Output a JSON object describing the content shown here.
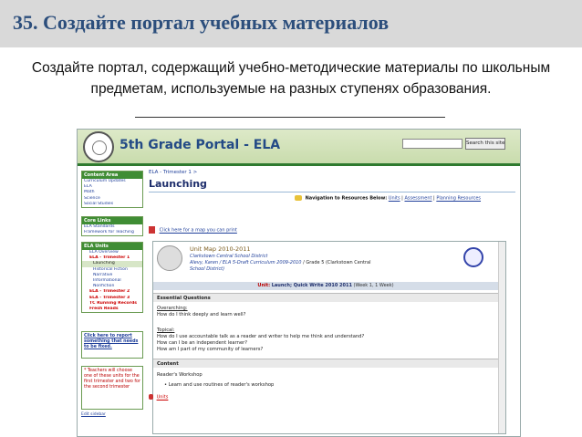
{
  "slide": {
    "title": "35. Создайте портал учебных материалов",
    "subtitle_line1": "Создайте портал, содержащий учебно-методические материалы по школьным",
    "subtitle_line2": "предметам, используемые на разных ступенях образования."
  },
  "colors": {
    "title": "#2c4e7c",
    "title_bar_bg": "#d9d9d9",
    "portal_green": "#3f8d34",
    "link_blue": "#1f3f9a"
  },
  "portal": {
    "name": "5th Grade Portal - ELA",
    "search_button": "Search this site",
    "sidebar": {
      "content_area": {
        "heading": "Content Area",
        "items": [
          "Curriculum Updates",
          "ELA",
          "Math",
          "Science",
          "Social Studies"
        ]
      },
      "core_links": {
        "heading": "Core Links",
        "items": [
          "ELA Standards",
          "Framework for Teaching"
        ]
      },
      "ela_units": {
        "heading": "ELA Units",
        "items": [
          "ELA Overview",
          "ELA - Trimester 1",
          "Launching",
          "Historical Fiction",
          "Narrative",
          "Informational",
          "Nonfiction",
          "ELA - Trimester 2",
          "ELA - Trimester 3",
          "TC Running Records",
          "Fresh Reads"
        ]
      },
      "report": {
        "text": "Click here to report something that needs to be fixed."
      },
      "teachers_note": "* Teachers will choose one of these units for the first trimester and two for the second trimester",
      "edit_sidebar": "Edit sidebar"
    },
    "main": {
      "breadcrumb": "ELA - Trimester 1 >",
      "page_title": "Launching",
      "nav_label": "Navigation to Resources Below:",
      "nav_links": [
        "Units",
        "Assessment",
        "Planning Resources"
      ],
      "pdf_link": "Click here for a map you can print",
      "unit_map": {
        "title": "Unit Map 2010-2011",
        "district": "Clarkstown Central School District",
        "author_line": "Alevy, Karen / ELA 5-Draft Curriculum 2009-2010",
        "grade_line": "/ Grade 5 (Clarkstown Central",
        "district_line2": "School District)",
        "unit_label": "Unit:",
        "unit_name": "Launch; Quick Write 2010 2011",
        "unit_week": "(Week 1, 1 Week)",
        "essential_heading": "Essential Questions",
        "overarching_label": "Overarching:",
        "overarching_q": "How do I think deeply and learn well?",
        "topical_label": "Topical:",
        "topical_q1": "How do I use accountable talk as a reader and writer to help me think and understand?",
        "topical_q2": "How can I be an independent learner?",
        "topical_q3": "How am I part of my community of learners?",
        "content_heading": "Content",
        "content_item": "Reader's Workshop",
        "content_bullet": "Learn and use routines of reader's workshop"
      },
      "units_link": "Units"
    }
  }
}
